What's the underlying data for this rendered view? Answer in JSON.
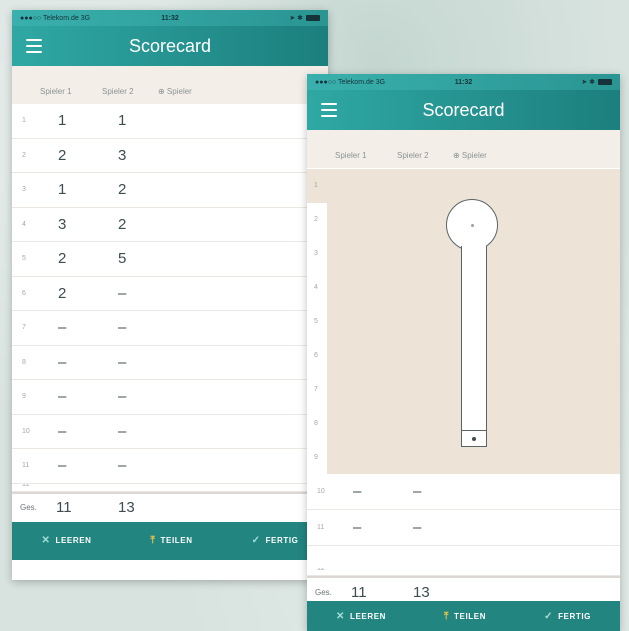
{
  "colors": {
    "header_start": "#2fa8a4",
    "header_end": "#1c7f7d",
    "toolbar": "#23857f",
    "paper": "#ede3d6"
  },
  "status": {
    "carrier": "●●●○○ Telekom.de 3G",
    "time": "11:32",
    "icons": "➤ ✱"
  },
  "app": {
    "title": "Scorecard",
    "menu_icon": "hamburger-icon"
  },
  "columns": {
    "player1": "Spieler 1",
    "player2": "Spieler 2",
    "add_player": "⊕ Spieler"
  },
  "phone1": {
    "rows": [
      {
        "n": "1",
        "p1": "1",
        "p2": "1"
      },
      {
        "n": "2",
        "p1": "2",
        "p2": "3"
      },
      {
        "n": "3",
        "p1": "1",
        "p2": "2"
      },
      {
        "n": "4",
        "p1": "3",
        "p2": "2"
      },
      {
        "n": "5",
        "p1": "2",
        "p2": "5"
      },
      {
        "n": "6",
        "p1": "2",
        "p2": "–"
      },
      {
        "n": "7",
        "p1": "–",
        "p2": "–"
      },
      {
        "n": "8",
        "p1": "–",
        "p2": "–"
      },
      {
        "n": "9",
        "p1": "–",
        "p2": "–"
      },
      {
        "n": "10",
        "p1": "–",
        "p2": "–"
      },
      {
        "n": "11",
        "p1": "–",
        "p2": "–"
      }
    ],
    "partial_row": {
      "n": "12",
      "p1": "–",
      "p2": "–"
    }
  },
  "phone2": {
    "sheet_numbers": [
      "1",
      "2",
      "3",
      "4",
      "5",
      "6",
      "7",
      "8",
      "9"
    ],
    "rows": [
      {
        "n": "10",
        "p1": "–",
        "p2": "–"
      },
      {
        "n": "11",
        "p1": "–",
        "p2": "–"
      }
    ],
    "partial_row": {
      "n": "12",
      "p1": "–",
      "p2": "–"
    }
  },
  "totals": {
    "label": "Ges.",
    "p1": "11",
    "p2": "13"
  },
  "toolbar": {
    "clear_icon": "✕",
    "clear": "LEEREN",
    "share_icon": "⤒",
    "share": "TEILEN",
    "done_icon": "✓",
    "done": "FERTIG"
  }
}
